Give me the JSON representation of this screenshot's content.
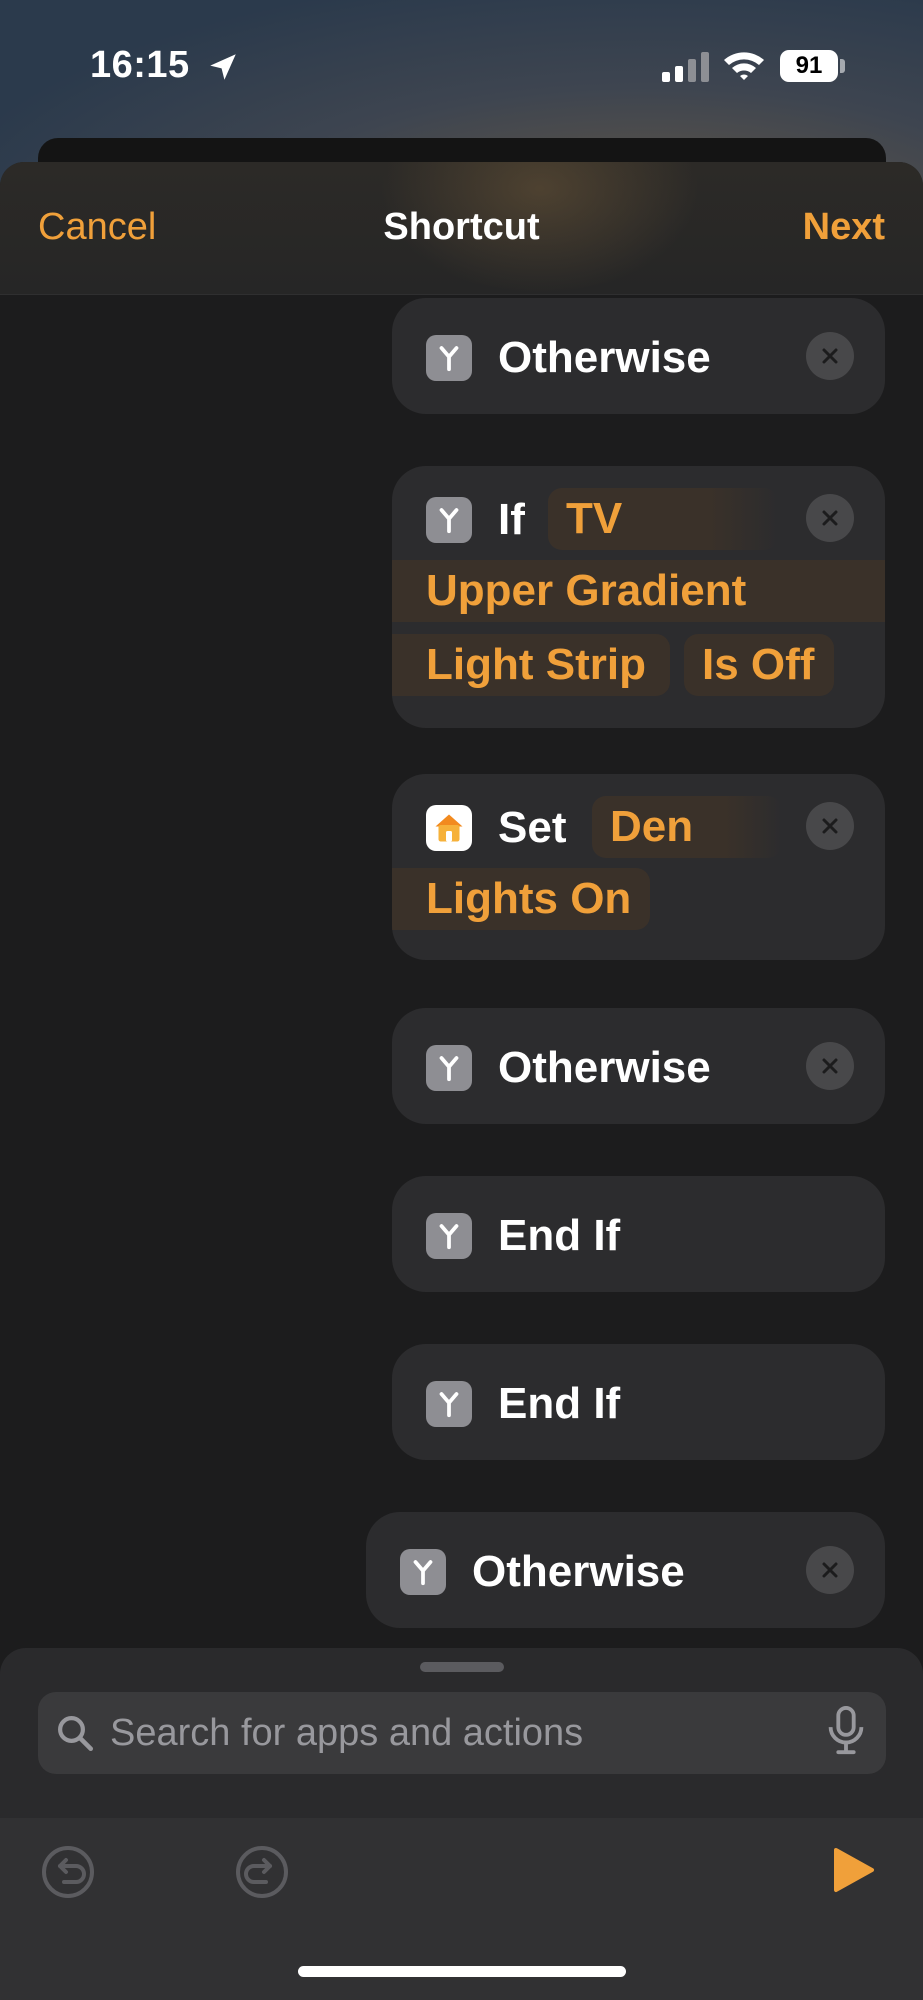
{
  "status_bar": {
    "time": "16:15",
    "battery": "91"
  },
  "nav": {
    "cancel": "Cancel",
    "title": "Shortcut",
    "next": "Next"
  },
  "actions": {
    "a1": {
      "keyword": "Otherwise"
    },
    "a2": {
      "keyword": "If",
      "subject": "TV",
      "line2": "Upper Gradient",
      "line3": "Light Strip",
      "condition": "Is Off"
    },
    "a3": {
      "keyword": "Set",
      "target": "Den",
      "value": "Lights On"
    },
    "a4": {
      "keyword": "Otherwise"
    },
    "a5": {
      "keyword": "End If"
    },
    "a6": {
      "keyword": "End If"
    },
    "a7": {
      "keyword": "Otherwise"
    }
  },
  "search": {
    "placeholder": "Search for apps and actions"
  },
  "colors": {
    "accent": "#f0a03a",
    "card": "#2c2c2e",
    "chip": "#3a3129",
    "background": "#1c1c1d"
  },
  "icons": {
    "status": [
      "location-arrow-icon",
      "cellular-signal-icon",
      "wifi-icon",
      "battery-icon"
    ],
    "actions": [
      "if-branch-icon",
      "home-icon",
      "close-icon"
    ],
    "toolbar": [
      "undo-icon",
      "redo-icon",
      "play-icon"
    ],
    "search": [
      "search-icon",
      "microphone-icon"
    ]
  }
}
